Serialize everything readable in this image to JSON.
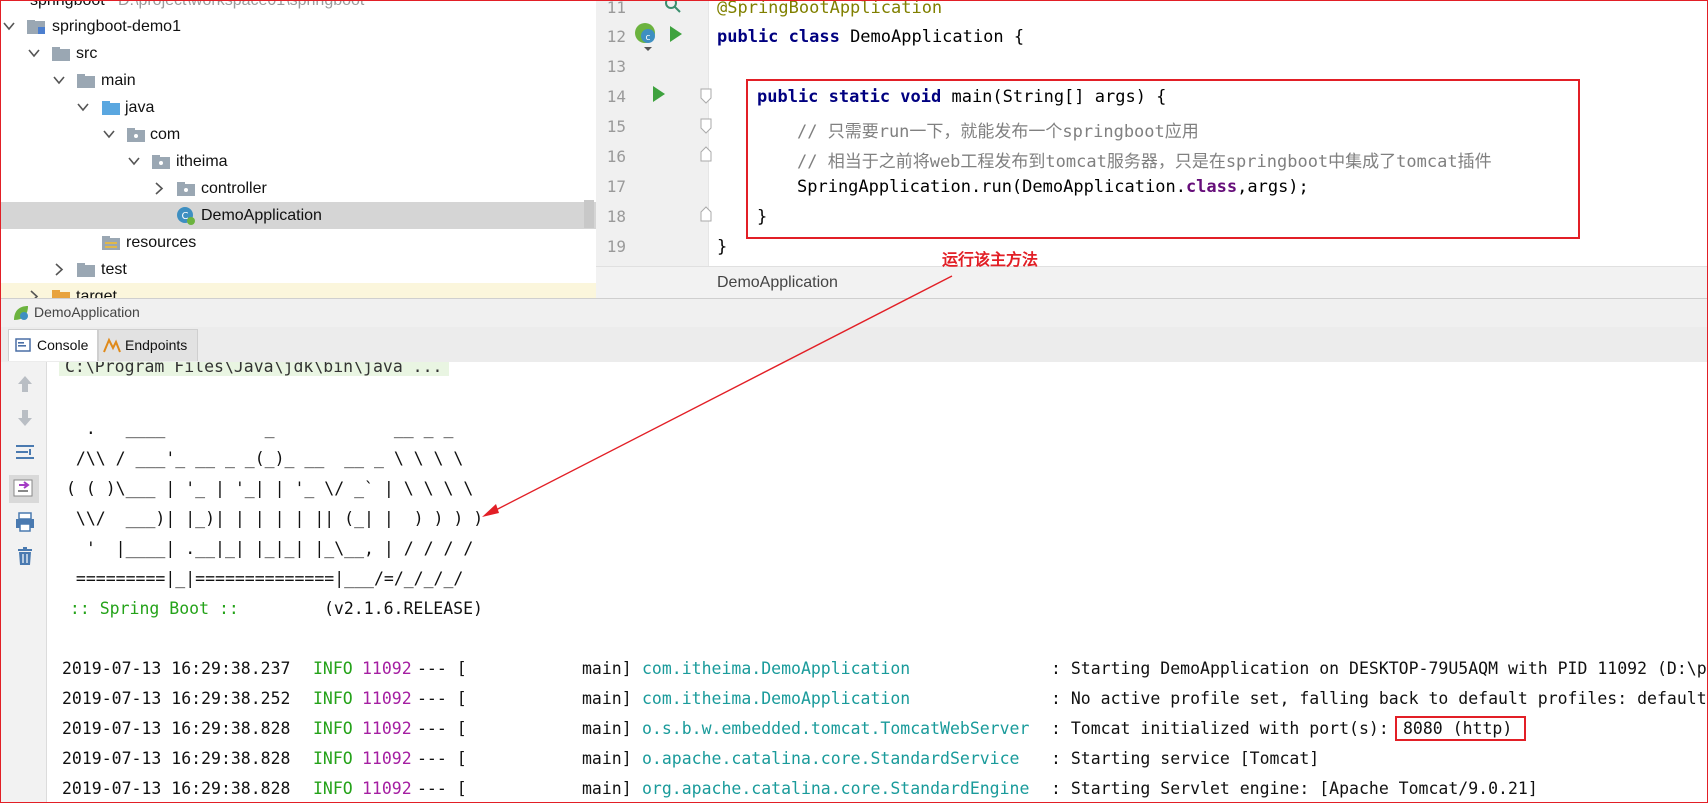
{
  "project_tree": {
    "root_label": "springboot",
    "root_path": "D:\\project\\workspace01\\springboot",
    "items": [
      {
        "label": "springboot-demo1"
      },
      {
        "label": "src"
      },
      {
        "label": "main"
      },
      {
        "label": "java"
      },
      {
        "label": "com"
      },
      {
        "label": "itheima"
      },
      {
        "label": "controller"
      },
      {
        "label": "DemoApplication"
      },
      {
        "label": "resources"
      },
      {
        "label": "test"
      },
      {
        "label": "target"
      }
    ]
  },
  "editor": {
    "line_numbers": [
      "11",
      "12",
      "13",
      "14",
      "15",
      "16",
      "17",
      "18",
      "19"
    ],
    "lines": {
      "l11": "@SpringBootApplication",
      "l12_kw": "public class",
      "l12_rest": " DemoApplication {",
      "l14_kw": "public static void",
      "l14_rest": " main(String[] args) {",
      "l15": "// 只需要run一下，就能发布一个springboot应用",
      "l16": "// 相当于之前将web工程发布到tomcat服务器，只是在springboot中集成了tomcat插件",
      "l17_a": "SpringApplication.run(DemoApplication.",
      "l17_kw": "class",
      "l17_b": ",args);",
      "l18": "}",
      "l19": "}"
    },
    "breadcrumb": "DemoApplication",
    "annotation_label": "运行该主方法"
  },
  "run_window": {
    "title": "DemoApplication",
    "tabs": [
      {
        "label": "Console"
      },
      {
        "label": "Endpoints"
      }
    ]
  },
  "console": {
    "cmd": "C:\\Program Files\\Java\\jdk\\bin\\java ...",
    "banner": [
      "  .   ____          _            __ _ _",
      " /\\\\ / ___'_ __ _ _(_)_ __  __ _ \\ \\ \\ \\",
      "( ( )\\___ | '_ | '_| | '_ \\/ _` | \\ \\ \\ \\",
      " \\\\/  ___)| |_)| | | | | || (_| |  ) ) ) )",
      "  '  |____| .__|_| |_|_| |_\\__, | / / / /",
      " =========|_|==============|___/=/_/_/_/"
    ],
    "spring_label": " :: Spring Boot ::",
    "spring_version": "(v2.1.6.RELEASE)",
    "logs": [
      {
        "time": "2019-07-13 16:29:38.237",
        "level": "INFO",
        "pid": "11092",
        "sep": "--- [",
        "thread": "main]",
        "logger": "com.itheima.DemoApplication",
        "msg": ": Starting DemoApplication on DESKTOP-79U5AQM with PID 11092 (D:\\p"
      },
      {
        "time": "2019-07-13 16:29:38.252",
        "level": "INFO",
        "pid": "11092",
        "sep": "--- [",
        "thread": "main]",
        "logger": "com.itheima.DemoApplication",
        "msg": ": No active profile set, falling back to default profiles: default"
      },
      {
        "time": "2019-07-13 16:29:38.828",
        "level": "INFO",
        "pid": "11092",
        "sep": "--- [",
        "thread": "main]",
        "logger": "o.s.b.w.embedded.tomcat.TomcatWebServer",
        "msg": ": Tomcat initialized with port(s):",
        "highlight": "8080 (http)"
      },
      {
        "time": "2019-07-13 16:29:38.828",
        "level": "INFO",
        "pid": "11092",
        "sep": "--- [",
        "thread": "main]",
        "logger": "o.apache.catalina.core.StandardService",
        "msg": ": Starting service [Tomcat]"
      },
      {
        "time": "2019-07-13 16:29:38.828",
        "level": "INFO",
        "pid": "11092",
        "sep": "--- [",
        "thread": "main]",
        "logger": "org.apache.catalina.core.StandardEngine",
        "msg": ": Starting Servlet engine: [Apache Tomcat/9.0.21]"
      }
    ]
  }
}
